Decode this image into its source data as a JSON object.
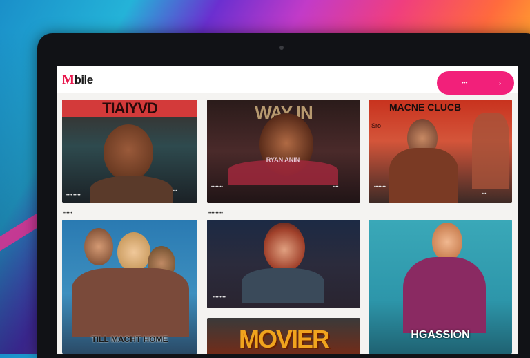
{
  "app": {
    "logo_mark": "M",
    "logo_rest": "bile"
  },
  "header": {
    "cta_label": "•••",
    "cta_arrow": "›"
  },
  "cards": [
    {
      "title": "TIAIYVD",
      "meta_left": "•••• •••••",
      "meta_right": "•••",
      "caption": "••••••"
    },
    {
      "title": "WAY IN",
      "subtitle": "RYAN ANIN",
      "meta_left": "••••••••",
      "meta_right": "••••",
      "caption": "••••••••••"
    },
    {
      "title": "MACNE CLUCB",
      "tag": "Sro",
      "meta_left": "••••••••",
      "meta_right": "•••"
    },
    {
      "title": "TILL MACHT HOME"
    },
    {
      "meta_left": "•••••••••"
    },
    {
      "title": "MOVIER"
    },
    {
      "title": "HGASSION"
    }
  ],
  "colors": {
    "accent": "#f2207a",
    "logo_red": "#e8184d"
  }
}
